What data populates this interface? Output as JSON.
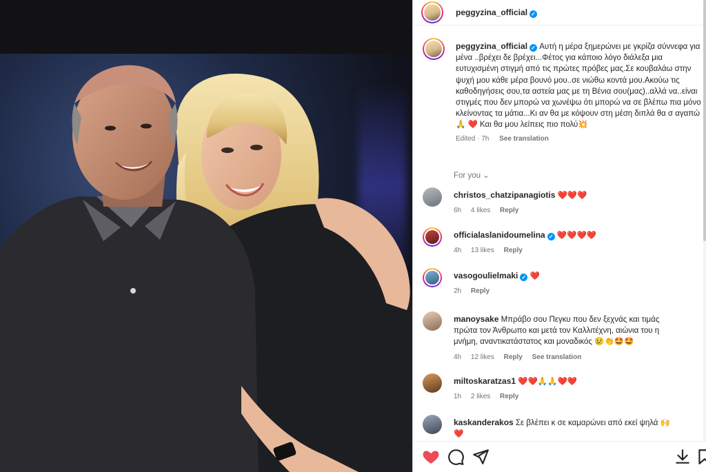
{
  "post": {
    "username": "peggyzina_official",
    "verified": true
  },
  "caption": {
    "username": "peggyzina_official",
    "text": "Αυτή η μέρα ξημερώνει με γκρίζα σύννεφα για μένα ..βρέχει δε βρέχει...Φέτος για κάποιο λόγο διάλεξα μια ευτυχισμένη στιγμή από τις πρώτες πρόβες μας.Σε κουβαλάω στην ψυχή μου κάθε μέρα βουνό μου..σε νιώθω κοντά μου.Ακούω τις καθοδηγήσεις σου,τα αστεία μας με τη Βένια σου(μας)..αλλά να..είναι στιγμές που δεν μπορώ να χωνέψω ότι μπορώ να σε βλέπω πια μόνο κλείνοντας τα μάτια...Κι αν θα με κόψουν στη μέση διπλά θα σ αγαπώ🙏 ❤️ Και θα μου λείπεις πιο πολύ💥",
    "edited": "Edited · 7h",
    "see_translation": "See translation"
  },
  "for_you": "For you",
  "comments": [
    {
      "username": "christos_chatzipanagiotis",
      "verified": false,
      "text": "❤️❤️❤️",
      "time": "6h",
      "likes": "4 likes",
      "reply": "Reply",
      "see_translation": ""
    },
    {
      "username": "officialaslanidoumelina",
      "verified": true,
      "text": "❤️❤️❤️❤️",
      "time": "4h",
      "likes": "13 likes",
      "reply": "Reply",
      "see_translation": ""
    },
    {
      "username": "vasogoulielmaki",
      "verified": true,
      "text": "❤️",
      "time": "2h",
      "likes": "",
      "reply": "Reply",
      "see_translation": ""
    },
    {
      "username": "manoysake",
      "verified": false,
      "text": "Μπράβο σου Πεγκυ που δεν ξεχνάς και τιμάς πρώτα τον Άνθρωπο και μετά τον Καλλιτέχνη, αιώνια του η μνήμη, αναντικατάστατος και μοναδικός 😢👏🤩🤩",
      "time": "4h",
      "likes": "12 likes",
      "reply": "Reply",
      "see_translation": "See translation"
    },
    {
      "username": "miltoskaratzas1",
      "verified": false,
      "text": "❤️❤️🙏🙏❤️❤️",
      "time": "1h",
      "likes": "2 likes",
      "reply": "Reply",
      "see_translation": ""
    },
    {
      "username": "kaskanderakos",
      "verified": false,
      "text": "Σε βλέπει κ σε καμαρώνει από εκεί ψηλά 🙌 ❤️",
      "time": "",
      "likes": "",
      "reply": "",
      "see_translation": ""
    }
  ],
  "icons": {
    "like": "heart-filled-icon",
    "comment": "comment-icon",
    "share": "share-icon",
    "save": "download-icon",
    "bookmark": "bookmark-icon"
  },
  "colors": {
    "verified": "#0095f6",
    "like": "#ed4956",
    "muted": "#737373"
  }
}
